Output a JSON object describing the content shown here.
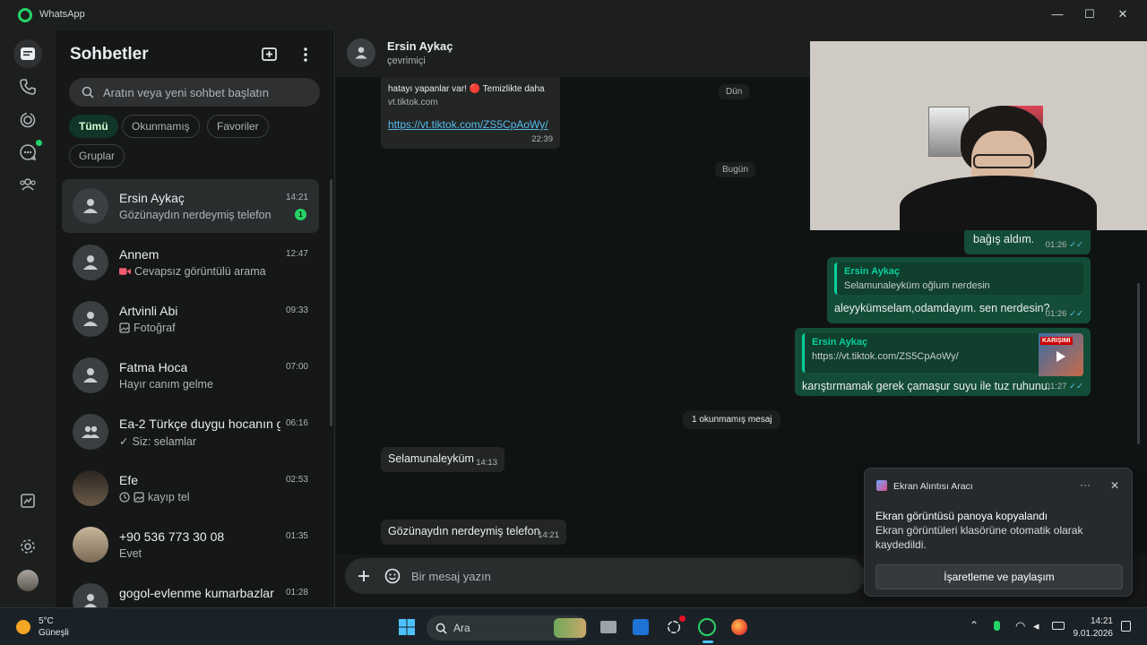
{
  "window": {
    "title": "WhatsApp",
    "minimize": "—",
    "maximize": "☐",
    "close": "✕"
  },
  "sidebar": {
    "title": "Sohbetler",
    "search_placeholder": "Aratın veya yeni sohbet başlatın",
    "filters": [
      "Tümü",
      "Okunmamış",
      "Favoriler",
      "Gruplar"
    ],
    "chats": [
      {
        "name": "Ersin Aykaç",
        "time": "14:21",
        "preview": "Gözünaydın nerdeymiş telefon",
        "unread": "1"
      },
      {
        "name": "Annem",
        "time": "12:47",
        "preview": "Cevapsız görüntülü arama"
      },
      {
        "name": "Artvinli Abi",
        "time": "09:33",
        "preview": "Fotoğraf"
      },
      {
        "name": "Fatma Hoca",
        "time": "07:00",
        "preview": "Hayır canım gelme"
      },
      {
        "name": "Ea-2 Türkçe duygu hocanın g...",
        "time": "06:16",
        "preview": "Siz: selamlar"
      },
      {
        "name": "Efe",
        "time": "02:53",
        "preview": "kayıp tel"
      },
      {
        "name": "+90 536 773 30 08",
        "time": "01:35",
        "preview": "Evet"
      },
      {
        "name": "gogol-evlenme kumarbazlar",
        "time": "01:28",
        "preview": ""
      }
    ]
  },
  "chat": {
    "name": "Ersin Aykaç",
    "status": "çevrimiçi",
    "composer_placeholder": "Bir mesaj yazın",
    "days": {
      "yesterday": "Dün",
      "today": "Bugün"
    },
    "unread_divider": "1 okunmamış mesaj",
    "messages": {
      "link_preview_text": "hatayı yapanlar var! 🔴 Temizlikte daha",
      "link_preview_domain": "vt.tiktok.com",
      "link_url": "https://vt.tiktok.com/ZS5CpAoWy/",
      "link_time": "22:39",
      "m1_text": "bağış aldım.",
      "m1_time": "01:26",
      "m2_quote_author": "Ersin Aykaç",
      "m2_quote_text": "Selamunaleyküm oğlum nerdesin",
      "m2_text": "aleyykümselam,odamdayım. sen nerdesin?",
      "m2_time": "01:26",
      "m3_quote_author": "Ersin Aykaç",
      "m3_quote_text": "https://vt.tiktok.com/ZS5CpAoWy/",
      "m3_thumb_label": "KARIŞIMI",
      "m3_text": "karıştırmamak gerek çamaşur suyu ile tuz ruhunu.",
      "m3_time": "01:27",
      "m4_text": "Selamunaleyküm",
      "m4_time": "14:13",
      "m5_text": "Gözünaydın nerdeymiş telefon",
      "m5_time": "14:21"
    }
  },
  "toast": {
    "app": "Ekran Alıntısı Aracı",
    "title": "Ekran görüntüsü panoya kopyalandı",
    "body": "Ekran görüntüleri klasörüne otomatik olarak kaydedildi.",
    "button": "İşaretleme ve paylaşım"
  },
  "taskbar": {
    "weather_temp": "5°C",
    "weather_desc": "Güneşli",
    "search_label": "Ara",
    "time": "14:21",
    "date": "9.01.2026"
  }
}
